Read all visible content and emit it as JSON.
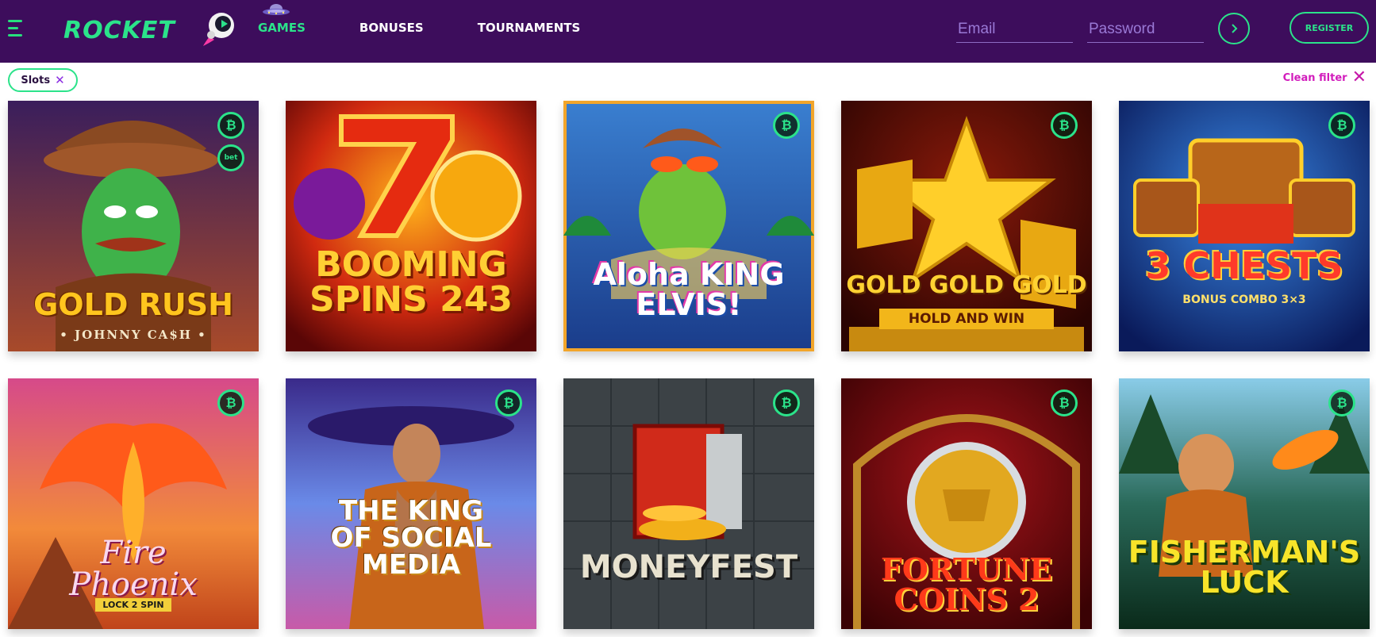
{
  "header": {
    "logo_text": "ROCKET",
    "nav": [
      "GAMES",
      "BONUSES",
      "TOURNAMENTS"
    ],
    "email_placeholder": "Email",
    "password_placeholder": "Password",
    "register_label": "REGISTER"
  },
  "filters": {
    "chip_label": "Slots",
    "clean_label": "Clean filter"
  },
  "games": [
    {
      "title": "GOLD RUSH",
      "subtitle": "• JOHNNY CA$H •",
      "badges": [
        "₿",
        "bet"
      ]
    },
    {
      "title": "BOOMING SPINS 243",
      "badges": []
    },
    {
      "title": "Aloha KING ELVIS!",
      "badges": [
        "₿"
      ]
    },
    {
      "title": "GOLD GOLD GOLD",
      "subtitle": "HOLD AND WIN",
      "badges": [
        "₿"
      ]
    },
    {
      "title": "3 CHESTS",
      "subtitle": "BONUS COMBO 3×3",
      "badges": [
        "₿"
      ]
    },
    {
      "title": "Fire Phoenix",
      "subtitle": "LOCK 2 SPIN",
      "badges": [
        "₿"
      ]
    },
    {
      "title": "THE KING OF SOCIAL MEDIA",
      "badges": [
        "₿"
      ]
    },
    {
      "title": "MONEYFEST",
      "badges": [
        "₿"
      ]
    },
    {
      "title": "FORTUNE COINS 2",
      "badges": [
        "₿"
      ]
    },
    {
      "title": "FISHERMAN'S LUCK",
      "badges": [
        "₿"
      ]
    }
  ],
  "colors": {
    "header_bg": "#3d0d5c",
    "accent": "#2be38a",
    "clean_filter": "#d21cbc"
  }
}
